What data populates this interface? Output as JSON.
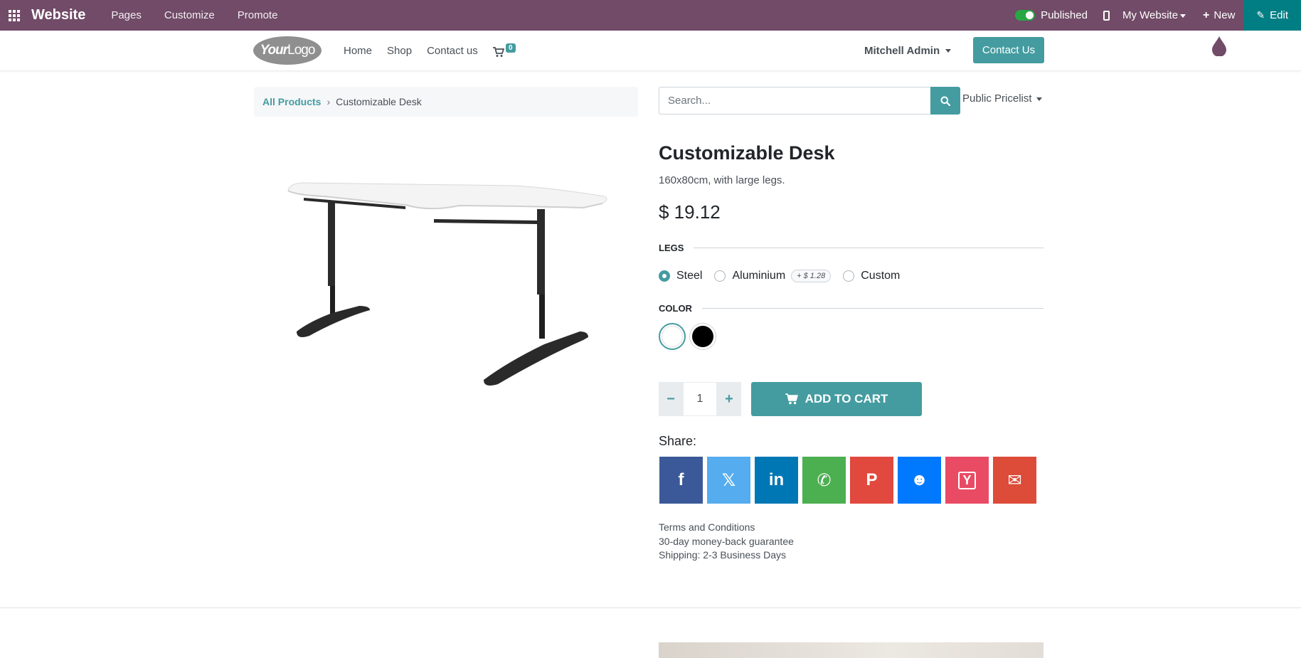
{
  "admin_bar": {
    "brand": "Website",
    "menu": [
      "Pages",
      "Customize",
      "Promote"
    ],
    "published_label": "Published",
    "my_website": "My Website",
    "new_label": "New",
    "edit_label": "Edit",
    "colors": {
      "bar": "#714b67",
      "edit": "#017e84",
      "toggle": "#28a745"
    }
  },
  "header": {
    "logo_text_1": "Your",
    "logo_text_2": "Logo",
    "nav": [
      "Home",
      "Shop",
      "Contact us"
    ],
    "cart_count": "0",
    "user": "Mitchell Admin",
    "contact_button": "Contact Us"
  },
  "breadcrumb": {
    "root": "All Products",
    "separator": "›",
    "current": "Customizable Desk"
  },
  "search": {
    "placeholder": "Search...",
    "pricelist": "Public Pricelist"
  },
  "product": {
    "name": "Customizable Desk",
    "description": "160x80cm, with large legs.",
    "price": "$ 19.12",
    "legs_heading": "LEGS",
    "legs_options": [
      {
        "label": "Steel",
        "checked": true
      },
      {
        "label": "Aluminium",
        "extra": "+ $ 1.28"
      },
      {
        "label": "Custom"
      }
    ],
    "color_heading": "COLOR",
    "colors": [
      {
        "name": "White",
        "hex": "#ffffff",
        "selected": true
      },
      {
        "name": "Black",
        "hex": "#000000"
      }
    ],
    "quantity": "1",
    "add_to_cart": "ADD TO CART"
  },
  "share": {
    "label": "Share:",
    "buttons": [
      {
        "name": "facebook",
        "glyph": "f",
        "color": "#3b5998"
      },
      {
        "name": "x",
        "glyph": "𝕏",
        "color": "#55acee"
      },
      {
        "name": "linkedin",
        "glyph": "in",
        "color": "#0077b5"
      },
      {
        "name": "whatsapp",
        "glyph": "✆",
        "color": "#4caf50"
      },
      {
        "name": "pinterest",
        "glyph": "P",
        "color": "#e1483e"
      },
      {
        "name": "reddit",
        "glyph": "☻",
        "color": "#0079ff"
      },
      {
        "name": "hacker-news",
        "glyph": "Y",
        "color": "#e94b64"
      },
      {
        "name": "email",
        "glyph": "✉",
        "color": "#dd4b39"
      }
    ]
  },
  "info": {
    "terms": "Terms and Conditions",
    "guarantee": "30-day money-back guarantee",
    "shipping": "Shipping: 2-3 Business Days"
  },
  "accent": "#449ca0"
}
